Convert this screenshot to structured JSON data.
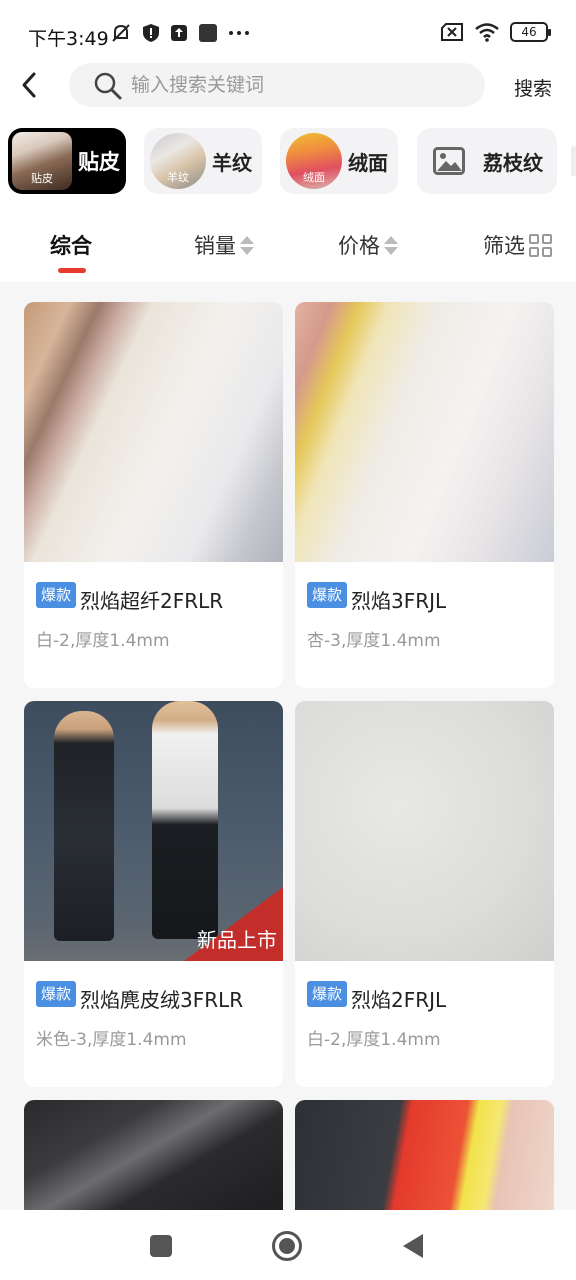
{
  "status_bar": {
    "time": "下午3:49",
    "battery": "46"
  },
  "search": {
    "placeholder": "输入搜索关键词",
    "button_label": "搜索"
  },
  "categories": [
    {
      "label": "贴皮",
      "thumb_label": "贴皮",
      "active": true
    },
    {
      "label": "羊纹",
      "thumb_label": "羊纹",
      "active": false
    },
    {
      "label": "绒面",
      "thumb_label": "绒面",
      "active": false
    },
    {
      "label": "荔枝纹",
      "active": false
    }
  ],
  "sort_tabs": [
    {
      "label": "综合",
      "active": true
    },
    {
      "label": "销量",
      "active": false
    },
    {
      "label": "价格",
      "active": false
    },
    {
      "label": "筛选",
      "active": false
    }
  ],
  "products": [
    {
      "badge": "爆款",
      "name": "烈焰超纤2FRLR",
      "spec": "白-2,厚度1.4mm"
    },
    {
      "badge": "爆款",
      "name": "烈焰3FRJL",
      "spec": "杏-3,厚度1.4mm"
    },
    {
      "badge": "爆款",
      "name": "烈焰麂皮绒3FRLR",
      "spec": "米色-3,厚度1.4mm"
    },
    {
      "badge": "爆款",
      "name": "烈焰2FRJL",
      "spec": "白-2,厚度1.4mm"
    }
  ],
  "banner_text": "新品上市",
  "colors": {
    "accent": "#e53b2c",
    "badge": "#4a8fe2"
  }
}
